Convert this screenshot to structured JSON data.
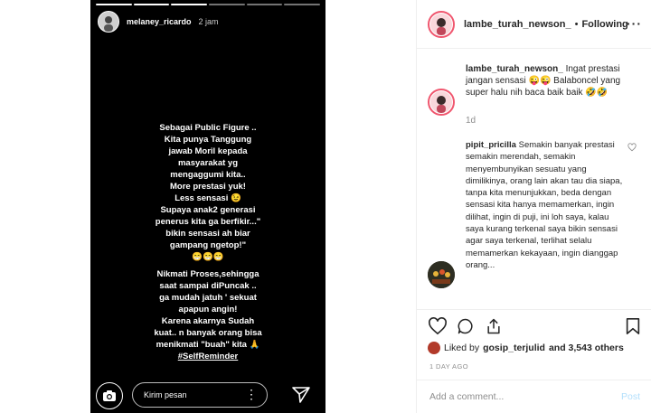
{
  "story": {
    "username": "melaney_ricardo",
    "time": "2 jam",
    "lines": [
      "Sebagai Public Figure ..",
      "Kita punya Tanggung",
      "jawab Moril kepada",
      "masyarakat yg",
      "mengaggumi kita..",
      "More prestasi yuk!",
      "Less sensasi 😉",
      "Supaya anak2 generasi",
      "penerus kita ga berfikir...\"",
      "bikin sensasi ah biar",
      "gampang ngetop!\"",
      "😁😁😁"
    ],
    "lines2": [
      "Nikmati Proses,sehingga",
      "saat sampai diPuncak ..",
      "ga mudah jatuh ' sekuat",
      "apapun angin!",
      "Karena akarnya Sudah",
      "kuat.. n banyak orang bisa",
      "menikmati \"buah\" kita 🙏",
      "#SelfReminder"
    ],
    "message_placeholder": "Kirim pesan"
  },
  "post": {
    "username": "lambe_turah_newson_",
    "follow_status": "Following",
    "caption_user": "lambe_turah_newson_",
    "caption": "Ingat prestasi jangan sensasi 😜😜 Balaboncel yang super halu nih baca baik baik 🤣🤣",
    "caption_age": "1d",
    "comment_user": "pipit_pricilla",
    "comment_text": "Semakin banyak prestasi semakin merendah, semakin menyembunyikan sesuatu yang dimilikinya, orang lain akan tau dia siapa, tanpa kita menunjukkan, beda dengan sensasi kita hanya memamerkan, ingin dilihat, ingin di puji, ini loh saya, kalau saya kurang terkenal saya bikin sensasi agar saya terkenal, terlihat selalu memamerkan kekayaan, ingin dianggap orang...",
    "liked_by_prefix": "Liked by",
    "liked_by_user": "gosip_terjulid",
    "liked_by_suffix": "and 3,543 others",
    "date": "1 DAY AGO",
    "add_comment_placeholder": "Add a comment...",
    "post_label": "Post"
  },
  "colors": {
    "story_bg": "#000000",
    "ring": "#f0566e",
    "post_disabled": "#b2dffc",
    "muted": "#8e8e8e"
  }
}
